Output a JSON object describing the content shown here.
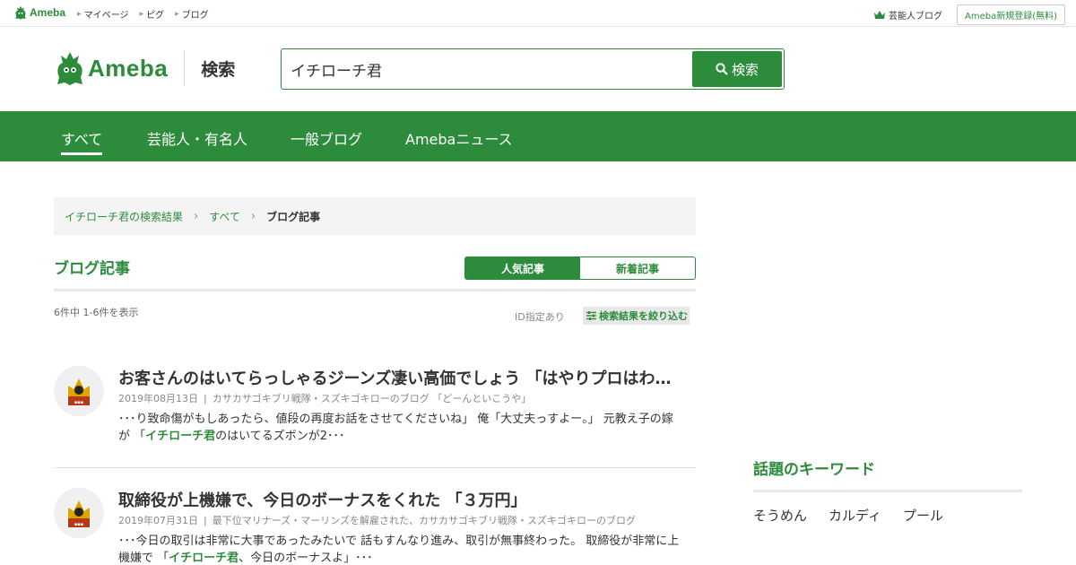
{
  "topbar": {
    "logo_text": "Ameba",
    "nav": [
      "マイページ",
      "ピグ",
      "ブログ"
    ],
    "celeb_blog": "芸能人ブログ",
    "register": "Ameba新規登録(無料)"
  },
  "header": {
    "brand": "Ameba",
    "section": "検索",
    "search_value": "イチローチ君",
    "search_button": "検索"
  },
  "tabs": [
    "すべて",
    "芸能人・有名人",
    "一般ブログ",
    "Amebaニュース"
  ],
  "breadcrumb": {
    "items": [
      "イチローチ君の検索結果",
      "すべて"
    ],
    "current": "ブログ記事"
  },
  "section": {
    "title": "ブログ記事",
    "sort_popular": "人気記事",
    "sort_new": "新着記事",
    "count": "6件中 1-6件を表示",
    "id_filter": "ID指定あり",
    "refine": "検索結果を絞り込む"
  },
  "results": [
    {
      "title": "お客さんのはいてらっしゃるジーンズ凄い高価でしょう 「はやりプロはわ…",
      "date": "2019年08月13日",
      "blog": "カサカサゴキブリ戦隊・スズキゴキローのブログ 「どーんといこうや」",
      "snippet_pre": "･･･り致命傷がもしあったら、値段の再度お話をさせてくださいね」 俺「大丈夫っすよー。」 元教え子の嫁が 「",
      "snippet_hit": "イチローチ君",
      "snippet_post": "のはいてるズボンが2･･･"
    },
    {
      "title": "取締役が上機嫌で、今日のボーナスをくれた 「３万円」",
      "date": "2019年07月31日",
      "blog": "最下位マリナーズ・マーリンズを解雇された、カサカサゴキブリ戦隊・スズキゴキローのブログ",
      "snippet_pre": "･･･今日の取引は非常に大事であったみたいで 話もすんなり進み、取引が無事終わった。 取締役が非常に上機嫌で 「",
      "snippet_hit": "イチローチ君",
      "snippet_post": "、今日のボーナスよ」･･･"
    }
  ],
  "sidebar": {
    "keywords_title": "話題のキーワード",
    "keywords": [
      "そうめん",
      "カルディ",
      "プール"
    ]
  },
  "colors": {
    "brand_green": "#2d8c3c"
  }
}
